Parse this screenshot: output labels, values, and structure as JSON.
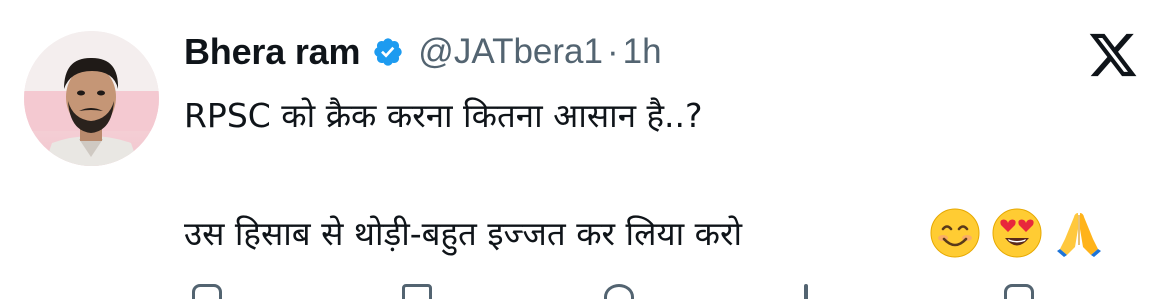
{
  "author": {
    "display_name": "Bhera ram",
    "handle": "@JATbera1",
    "separator": "·",
    "time": "1h",
    "verified": true
  },
  "tweet": {
    "line1": "RPSC को क्रैक करना कितना आसान है..?",
    "line2": "उस हिसाब से थोड़ी-बहुत इज्जत कर लिया करो",
    "emojis": [
      "smiling-face-emoji",
      "heart-eyes-emoji",
      "folded-hands-emoji"
    ]
  },
  "platform": {
    "logo": "x-logo-icon"
  },
  "colors": {
    "text_primary": "#0f1419",
    "text_secondary": "#536471",
    "verified_blue": "#1d9bf0"
  }
}
